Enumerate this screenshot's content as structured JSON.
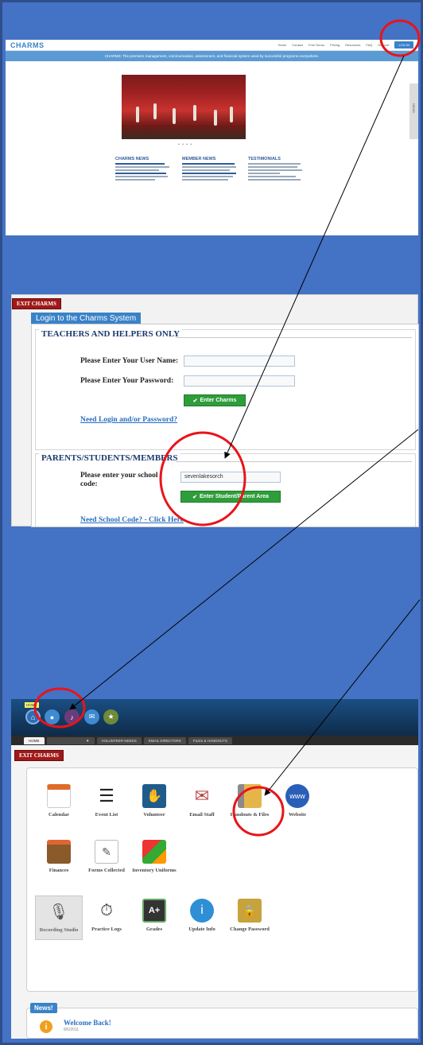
{
  "home": {
    "logo": "CHARMS",
    "nav": [
      "Home",
      "Contact",
      "Free Demo",
      "Pricing",
      "Resources",
      "FAQ",
      "Support"
    ],
    "login_label": "LOG IN",
    "banner": "CHARMS: The premiere management, communication, assessment, and financial system used by successful programs everywhere.",
    "side_tab": "DEMO",
    "dots": "• • • •",
    "columns": [
      {
        "title": "CHARMS NEWS"
      },
      {
        "title": "MEMBER NEWS"
      },
      {
        "title": "TESTIMONIALS"
      }
    ]
  },
  "login": {
    "exit_label": "EXIT CHARMS",
    "tab_label": "Login to the Charms System",
    "teachers": {
      "title": "TEACHERS AND HELPERS ONLY",
      "username_label": "Please Enter Your User Name:",
      "password_label": "Please Enter Your Password:",
      "username_value": "",
      "password_value": "",
      "enter_button": "Enter Charms",
      "help_link": "Need Login and/or Password?"
    },
    "parents": {
      "title": "PARENTS/STUDENTS/MEMBERS",
      "code_label_1": "Please enter your school",
      "code_label_2": "code:",
      "code_value": "sevenlakesorch",
      "enter_button": "Enter Student/Parent Area",
      "help_link": "Need School Code? - Click Here"
    }
  },
  "app": {
    "home_tag": "HOME",
    "tabs": [
      "HOME",
      "",
      "VOLUNTEER NEEDS",
      "EMAIL DIRECTORS",
      "FILES & HANDOUTS"
    ],
    "exit_label": "EXIT CHARMS",
    "tiles": [
      {
        "label": "Calendar",
        "icon": "calendar-icon"
      },
      {
        "label": "Event List",
        "icon": "list-icon"
      },
      {
        "label": "Volunteer",
        "icon": "volunteer-icon"
      },
      {
        "label": "Email Staff",
        "icon": "email-icon"
      },
      {
        "label": "Handouts & Files",
        "icon": "folder-icon"
      },
      {
        "label": "Website",
        "icon": "globe-icon"
      },
      {
        "label": "Finances",
        "icon": "wallet-icon"
      },
      {
        "label": "Forms Collected",
        "icon": "forms-icon"
      },
      {
        "label": "Inventory Uniforms",
        "icon": "blocks-icon"
      },
      {
        "label": "Recording Studio",
        "icon": "microphone-icon"
      },
      {
        "label": "Practice Logs",
        "icon": "stopwatch-icon"
      },
      {
        "label": "Grades",
        "icon": "grade-icon"
      },
      {
        "label": "Update Info",
        "icon": "user-info-icon"
      },
      {
        "label": "Change Password",
        "icon": "padlock-icon"
      }
    ],
    "news_tab": "News!",
    "news_title": "Welcome Back!",
    "news_date": "8/6/2011"
  },
  "colors": {
    "background": "#4472c4",
    "annotation": "#e8141b",
    "exit_button": "#a01818",
    "green_button": "#2e9e3a",
    "link": "#2a6fc0"
  }
}
